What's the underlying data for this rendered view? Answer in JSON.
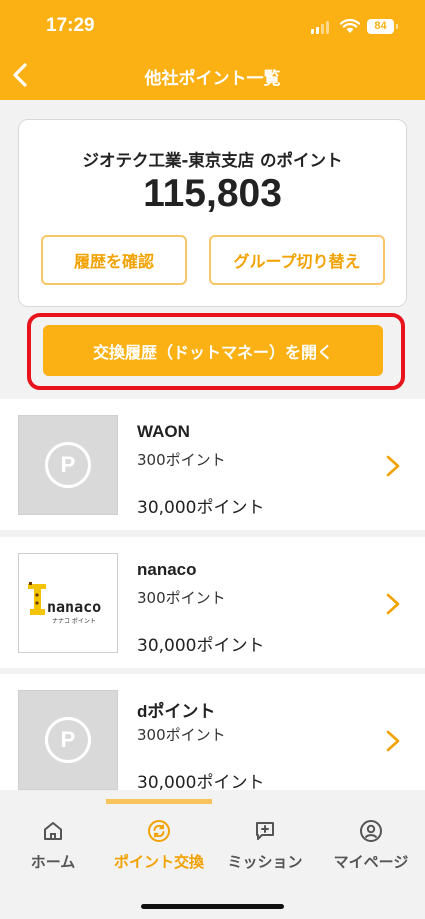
{
  "status_bar": {
    "time": "17:29",
    "battery": "84"
  },
  "header": {
    "title": "他社ポイント一覧"
  },
  "card": {
    "title": "ジオテク工業-東京支店 のポイント",
    "points": "115,803",
    "history_button": "履歴を確認",
    "group_button": "グループ切り替え"
  },
  "exchange_button": "交換履歴（ドットマネー）を開く",
  "items": [
    {
      "name": "WAON",
      "rate": "300ポイント",
      "total": "30,000ポイント",
      "icon": "placeholder-p-icon"
    },
    {
      "name": "nanaco",
      "rate": "300ポイント",
      "total": "30,000ポイント",
      "icon": "nanaco-logo",
      "logo_text": "nanaco",
      "logo_sub": "ナナコ ポイント"
    },
    {
      "name": "dポイント",
      "rate": "300ポイント",
      "total": "30,000ポイント",
      "icon": "placeholder-p-icon"
    }
  ],
  "nav": [
    {
      "label": "ホーム",
      "icon": "home-icon",
      "active": false
    },
    {
      "label": "ポイント交換",
      "icon": "exchange-icon",
      "active": true
    },
    {
      "label": "ミッション",
      "icon": "mission-icon",
      "active": false
    },
    {
      "label": "マイページ",
      "icon": "user-icon",
      "active": false
    }
  ],
  "colors": {
    "accent": "#fbb114",
    "accent_text": "#f2a200",
    "highlight_border": "#e8141c"
  }
}
